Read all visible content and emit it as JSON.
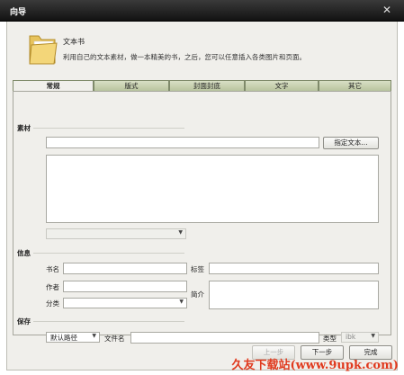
{
  "window": {
    "title": "向导"
  },
  "header": {
    "app_name": "文本书",
    "description": "利用自己的文本素材，做一本精美的书，之后，您可以任意插入各类图片和页面。"
  },
  "tabs": [
    {
      "label": "常规",
      "active": true
    },
    {
      "label": "版式",
      "active": false
    },
    {
      "label": "封面封底",
      "active": false
    },
    {
      "label": "文字",
      "active": false
    },
    {
      "label": "其它",
      "active": false
    }
  ],
  "material": {
    "section_label": "素材",
    "file_value": "",
    "specify_button": "指定文本..."
  },
  "info": {
    "section_label": "信息",
    "book_name_label": "书名",
    "author_label": "作者",
    "category_label": "分类",
    "tag_label": "标签",
    "intro_label": "简介"
  },
  "save": {
    "section_label": "保存",
    "path_select_value": "默认路径",
    "filename_label": "文件名",
    "type_label": "类型",
    "type_value": "ibk"
  },
  "buttons": {
    "prev": "上一步",
    "next": "下一步",
    "finish": "完成"
  },
  "watermark": "久友下载站(www.9upk.com)",
  "colors": {
    "watermark": "#e03a1e",
    "titlebar": "#1e1e1e",
    "tab_inactive": "#c4cda8"
  }
}
